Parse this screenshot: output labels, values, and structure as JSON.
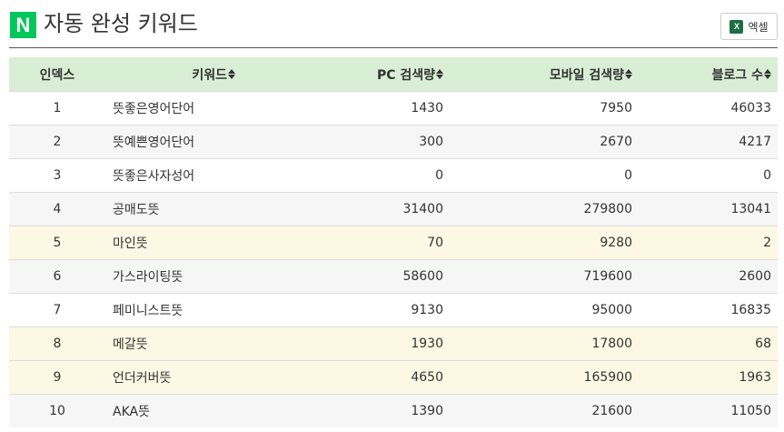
{
  "header": {
    "logo_letter": "N",
    "title": "자동 완성 키워드",
    "excel_label": "엑셀",
    "excel_icon_letter": "X"
  },
  "table": {
    "columns": [
      "인덱스",
      "키워드",
      "PC 검색량",
      "모바일 검색량",
      "블로그 수"
    ],
    "rows": [
      {
        "index": "1",
        "keyword": "뜻좋은영어단어",
        "pc": "1430",
        "mobile": "7950",
        "blog": "46033",
        "highlight": false
      },
      {
        "index": "2",
        "keyword": "뜻예쁜영어단어",
        "pc": "300",
        "mobile": "2670",
        "blog": "4217",
        "highlight": false
      },
      {
        "index": "3",
        "keyword": "뜻좋은사자성어",
        "pc": "0",
        "mobile": "0",
        "blog": "0",
        "highlight": false
      },
      {
        "index": "4",
        "keyword": "공매도뜻",
        "pc": "31400",
        "mobile": "279800",
        "blog": "13041",
        "highlight": false
      },
      {
        "index": "5",
        "keyword": "마인뜻",
        "pc": "70",
        "mobile": "9280",
        "blog": "2",
        "highlight": true
      },
      {
        "index": "6",
        "keyword": "가스라이팅뜻",
        "pc": "58600",
        "mobile": "719600",
        "blog": "2600",
        "highlight": false
      },
      {
        "index": "7",
        "keyword": "페미니스트뜻",
        "pc": "9130",
        "mobile": "95000",
        "blog": "16835",
        "highlight": false
      },
      {
        "index": "8",
        "keyword": "메갈뜻",
        "pc": "1930",
        "mobile": "17800",
        "blog": "68",
        "highlight": true
      },
      {
        "index": "9",
        "keyword": "언더커버뜻",
        "pc": "4650",
        "mobile": "165900",
        "blog": "1963",
        "highlight": true
      },
      {
        "index": "10",
        "keyword": "AKA뜻",
        "pc": "1390",
        "mobile": "21600",
        "blog": "11050",
        "highlight": false
      }
    ]
  },
  "colors": {
    "brand_green": "#03c75a",
    "header_row_bg": "#d9efd5",
    "highlight_row_bg": "#fcf8e3",
    "stripe_bg": "#f6f6f6",
    "excel_green": "#1d6f42"
  }
}
